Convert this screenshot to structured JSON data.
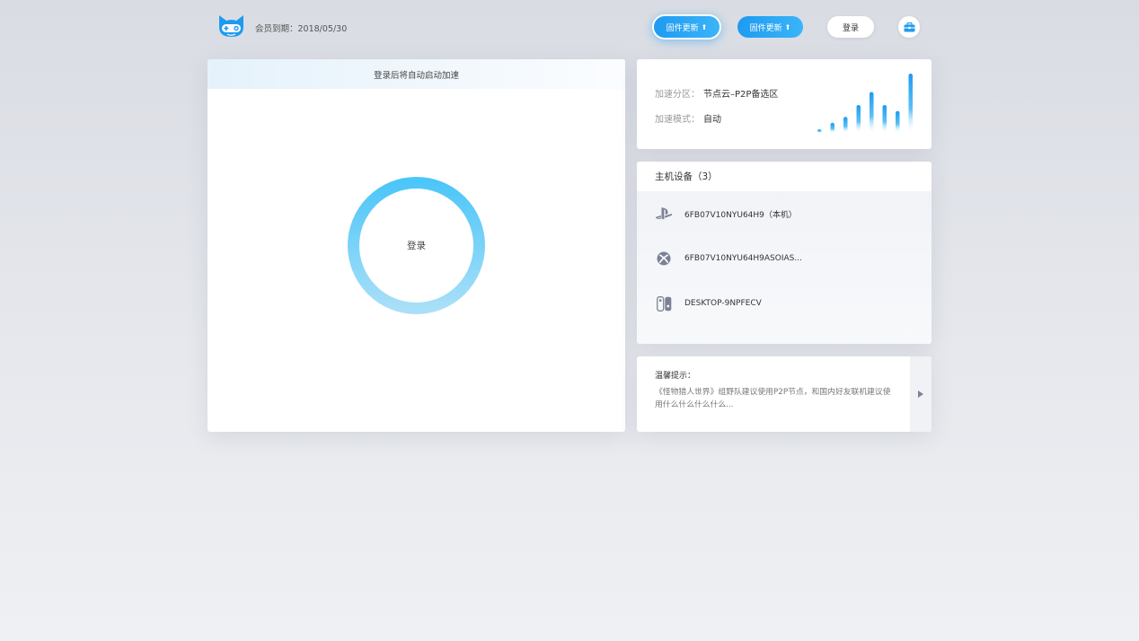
{
  "header": {
    "membership_text": "会员到期：2018/05/30",
    "firmware_button_1": "固件更新",
    "firmware_button_2": "固件更新",
    "arrow_glyph": "⬆",
    "login_button": "登录",
    "toolbox_icon": "toolbox-icon",
    "logo_icon": "cat-gamepad-logo-icon"
  },
  "left": {
    "banner_text": "登录后将自动启动加速",
    "ring_label": "登录"
  },
  "area": {
    "zone_label": "加速分区：",
    "zone_value": "节点云–P2P备选区",
    "mode_label": "加速模式：",
    "mode_value": "自动",
    "signal_levels": [
      0.06,
      0.17,
      0.27,
      0.47,
      0.69,
      0.47,
      0.37,
      1.0
    ]
  },
  "devices": {
    "title": "主机设备（3）",
    "items": [
      {
        "icon": "playstation-icon",
        "name": "6FB07V10NYU64H9（本机）"
      },
      {
        "icon": "xbox-icon",
        "name": "6FB07V10NYU64H9ASOIAS..."
      },
      {
        "icon": "switch-icon",
        "name": "DESKTOP-9NPFECV"
      }
    ]
  },
  "tip": {
    "title": "温馨提示：",
    "body": "《怪物猎人世界》组野队建议使用P2P节点，和国内好友联机建议使用什么什么什么什么..."
  },
  "colors": {
    "accent": "#1e9bf0",
    "accent_light": "#3bb4f8",
    "ring_top": "#4cc6f8",
    "ring_bottom": "#a9dff8"
  }
}
